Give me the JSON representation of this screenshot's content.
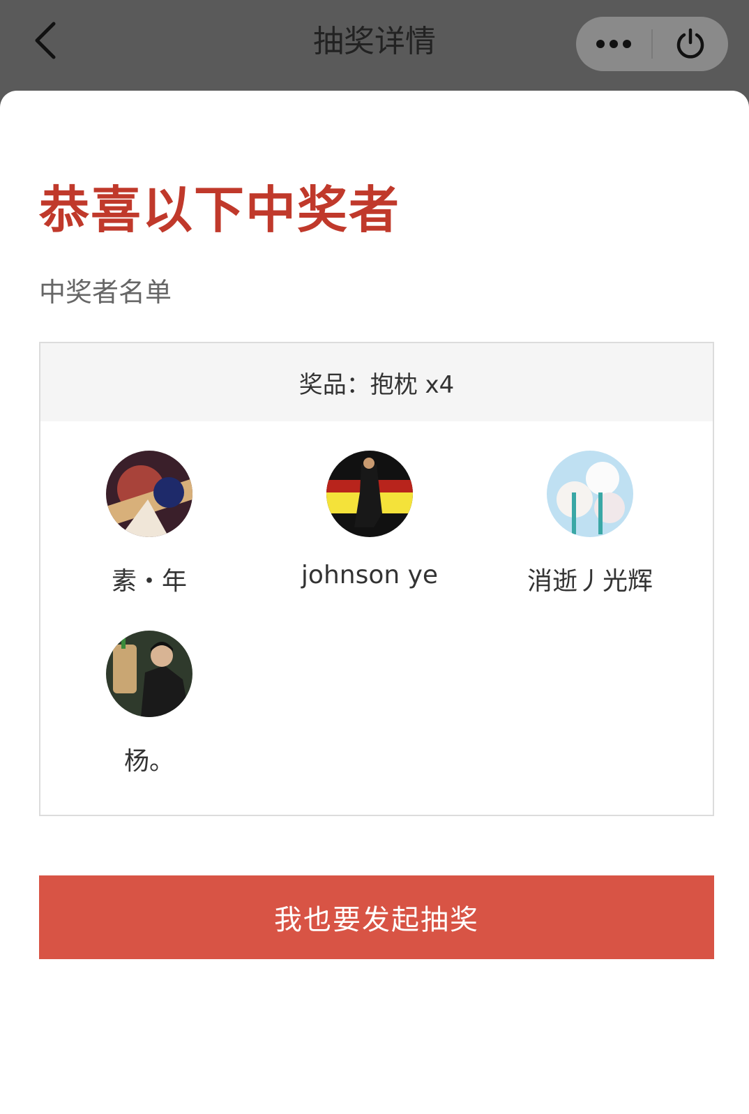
{
  "nav": {
    "title": "抽奖详情",
    "back_icon": "chevron-left-icon",
    "more_icon": "more-dots-icon",
    "close_icon": "power-icon"
  },
  "main": {
    "headline": "恭喜以下中奖者",
    "list_title": "中奖者名单",
    "prize": "奖品：抱枕 x4",
    "winners": [
      {
        "name": "素・年"
      },
      {
        "name": "johnson ye"
      },
      {
        "name": "消逝丿光辉"
      },
      {
        "name": "杨。"
      }
    ],
    "cta_label": "我也要发起抽奖"
  },
  "colors": {
    "accent": "#c0392b",
    "button": "#d85445",
    "topbar": "#5a5a5a"
  }
}
